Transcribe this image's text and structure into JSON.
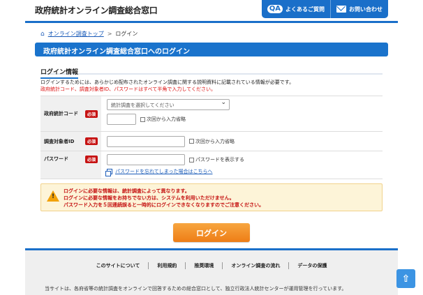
{
  "header": {
    "site_title": "政府統計オンライン調査総合窓口",
    "faq_label": "よくあるご質問",
    "contact_label": "お問い合わせ"
  },
  "breadcrumb": {
    "home": "オンライン調査トップ",
    "current": "ログイン"
  },
  "page_title": "政府統計オンライン調査総合窓口へのログイン",
  "section_title": "ログイン情報",
  "intro": {
    "line1": "ログインするためには、あらかじめ配布されたオンライン調査に関する説明資料に記載されている情報が必要です。",
    "line2": "政府統計コード、調査対象者ID、パスワードはすべて半角で入力してください。"
  },
  "form": {
    "required_badge": "必須",
    "stat_code": {
      "label": "政府統計コード",
      "select_placeholder": "統計調査を選択してください",
      "remember_label": "次回から入力省略"
    },
    "respondent_id": {
      "label": "調査対象者ID",
      "remember_label": "次回から入力省略"
    },
    "password": {
      "label": "パスワード",
      "show_label": "パスワードを表示する",
      "forgot_link": "パスワードを忘れてしまった場合はこちらへ"
    }
  },
  "warning": {
    "line1": "ログインに必要な情報は、統計調査によって異なります。",
    "line2": "ログインに必要な情報をお持ちでない方は、システムを利用いただけません。",
    "line3": "パスワード入力を５回連続誤ると一時的にログインできなくなりますのでご注意ください。"
  },
  "login_button": "ログイン",
  "footer": {
    "nav": [
      "このサイトについて",
      "利用規約",
      "推奨環境",
      "オンライン調査の流れ",
      "データの保護"
    ],
    "note": "当サイトは、各府省等の統計調査をオンラインで回答するための総合窓口として、独立行政法人統計センターが運用管理を行っています。"
  },
  "icons": {
    "faq": "qa-icon",
    "contact": "mail-icon",
    "home": "home-icon",
    "warning": "warning-icon",
    "to_top": "arrow-up-icon"
  },
  "colors": {
    "brand_blue": "#1a73cc",
    "required_red": "#c61212",
    "login_orange": "#ee7d16",
    "warning_bg": "#fdf4d8"
  }
}
